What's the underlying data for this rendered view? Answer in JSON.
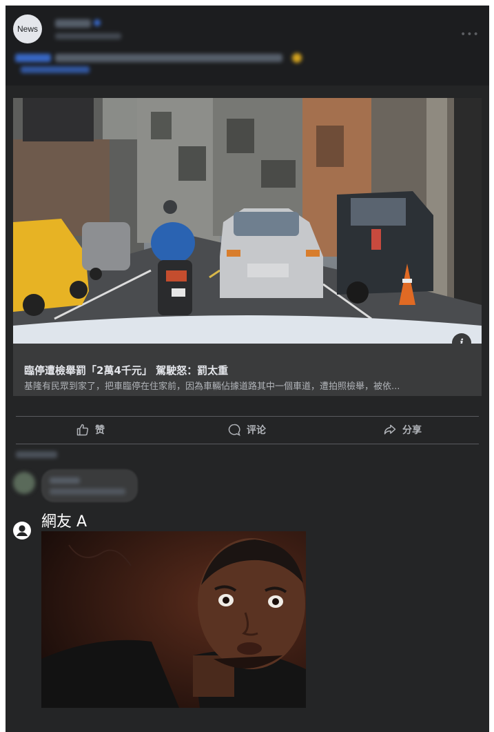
{
  "post": {
    "avatar_text": "News",
    "more_icon": "more-dots-icon"
  },
  "link": {
    "title": "臨停遭檢舉罰「2萬4千元」 駕駛怒：罰太重",
    "description": "基隆有民眾到家了，把車臨停在住家前，因為車輛佔據道路其中一個車道，遭拍照檢舉，被依...",
    "info_icon": "i"
  },
  "actions": [
    {
      "label": "赞",
      "icon": "thumbs-up-icon"
    },
    {
      "label": "评论",
      "icon": "comment-icon"
    },
    {
      "label": "分享",
      "icon": "share-icon"
    }
  ],
  "comment": {
    "user_name": "網友 A",
    "user_icon": "user-avatar-icon"
  },
  "colors": {
    "background": "#242526",
    "card": "#3a3b3c",
    "text_primary": "#e4e6eb",
    "text_secondary": "#b0b3b8"
  }
}
